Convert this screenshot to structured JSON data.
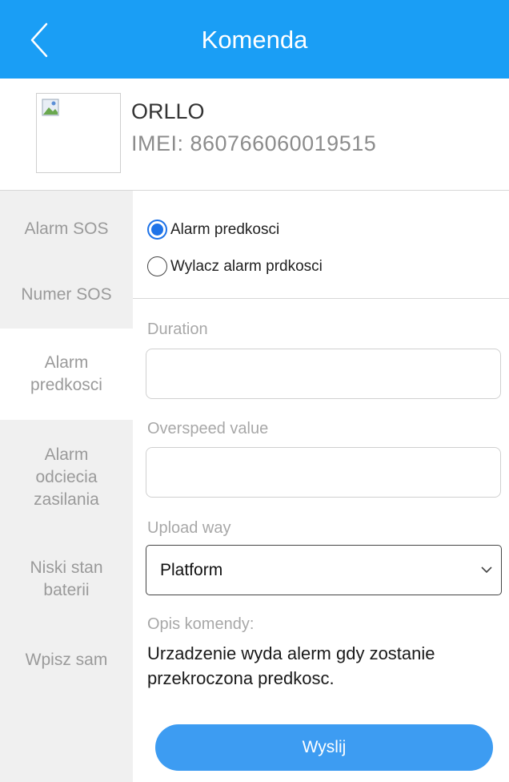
{
  "header": {
    "title": "Komenda",
    "color": "#1a9ef5"
  },
  "device": {
    "name": "ORLLO",
    "imei": "IMEI:  860766060019515"
  },
  "sidebar": {
    "items": [
      {
        "label": "Alarm SOS",
        "active": false
      },
      {
        "label": "Numer SOS",
        "active": false
      },
      {
        "label": "Alarm predkosci",
        "active": true
      },
      {
        "label": "Alarm odciecia zasilania",
        "active": false
      },
      {
        "label": "Niski stan baterii",
        "active": false
      },
      {
        "label": "Wpisz sam",
        "active": false
      }
    ]
  },
  "content": {
    "radios": [
      {
        "label": "Alarm predkosci",
        "checked": true
      },
      {
        "label": "Wylacz alarm prdkosci",
        "checked": false
      }
    ],
    "duration": {
      "label": "Duration",
      "value": ""
    },
    "overspeed": {
      "label": "Overspeed value",
      "value": ""
    },
    "upload_way": {
      "label": "Upload way",
      "selected": "Platform"
    },
    "description": {
      "label": "Opis komendy:",
      "text": "Urzadzenie wyda alerm gdy zostanie przekroczona predkosc."
    },
    "send_label": "Wyslij",
    "accent": "#1e73e8"
  }
}
